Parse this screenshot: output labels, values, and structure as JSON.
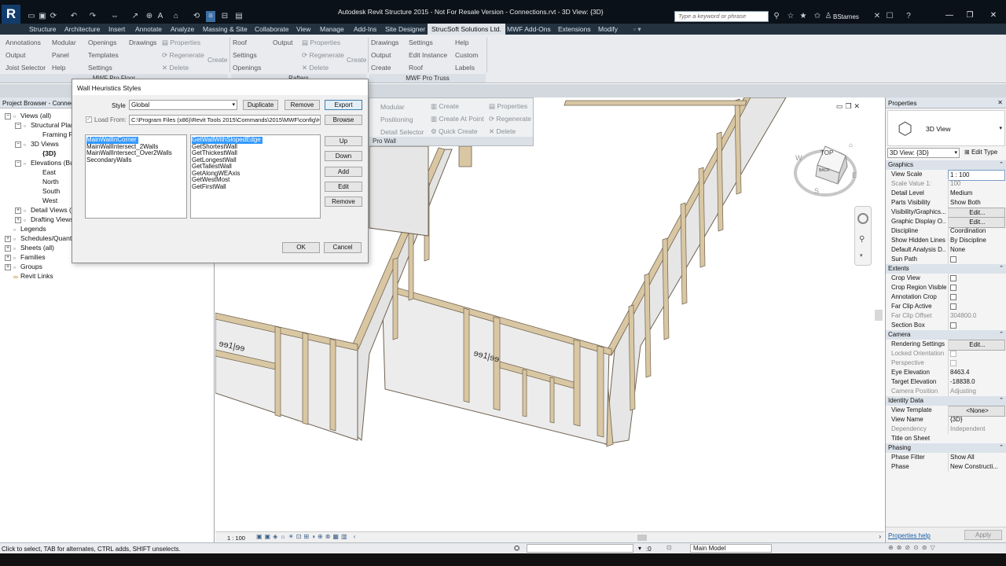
{
  "app": {
    "title": "Autodesk Revit Structure 2015 - Not For Resale Version -     Connections.rvt - 3D View: {3D}",
    "logo_letter": "R",
    "search_placeholder": "Type a keyword or phrase",
    "user": "BStarnes"
  },
  "tabs": [
    "Structure",
    "Architecture",
    "Insert",
    "Annotate",
    "Analyze",
    "Massing & Site",
    "Collaborate",
    "View",
    "Manage",
    "Add-Ins",
    "Site Designer",
    "StrucSoft Solutions Ltd.",
    "MWF Add-Ons",
    "Extensions",
    "Modify"
  ],
  "active_tab": "StrucSoft Solutions Ltd.",
  "ribbon": {
    "floor": {
      "annotations": "Annotations",
      "modular": "Modular",
      "openings": "Openings",
      "drawings": "Drawings",
      "properties": "Properties",
      "output": "Output",
      "panel": "Panel",
      "templates": "Templates",
      "regenerate": "Regenerate",
      "create": "Create",
      "joist_selector": "Joist Selector",
      "help": "Help",
      "settings": "Settings",
      "delete": "Delete",
      "panel_label": "MWF Pro Floor"
    },
    "rafters": {
      "roof": "Roof",
      "output": "Output",
      "properties": "Properties",
      "settings": "Settings",
      "regenerate": "Regenerate",
      "create": "Create",
      "openings": "Openings",
      "delete": "Delete",
      "panel_label": "Rafters"
    },
    "truss": {
      "drawings": "Drawings",
      "settings": "Settings",
      "help": "Help",
      "output": "Output",
      "edit_instance": "Edit Instance",
      "custom": "Custom",
      "create": "Create",
      "roof": "Roof",
      "labels": "Labels",
      "panel_label": "MWF Pro Truss"
    }
  },
  "wall_panel": {
    "modular": "Modular",
    "create": "Create",
    "properties": "Properties",
    "positioning": "Positioning",
    "create_at_point": "Create At Point",
    "regenerate": "Regenerate",
    "detail_selector": "Detail Selector",
    "quick_create": "Quick Create",
    "delete": "Delete",
    "panel_label": "Pro Wall"
  },
  "project_browser": {
    "title": "Project Browser - Connecti",
    "items": [
      {
        "label": "Views (all)",
        "toggle": "−"
      },
      {
        "label": "Structural Plans",
        "toggle": "−"
      },
      {
        "label": "Framing Plan",
        "toggle": ""
      },
      {
        "label": "3D Views",
        "toggle": "−"
      },
      {
        "label": "{3D}",
        "toggle": ""
      },
      {
        "label": "Elevations (Buildin",
        "toggle": "−"
      },
      {
        "label": "East",
        "toggle": ""
      },
      {
        "label": "North",
        "toggle": ""
      },
      {
        "label": "South",
        "toggle": ""
      },
      {
        "label": "West",
        "toggle": ""
      },
      {
        "label": "Detail Views (Deta",
        "toggle": "+"
      },
      {
        "label": "Drafting Views (D",
        "toggle": "+"
      },
      {
        "label": "Legends",
        "toggle": ""
      },
      {
        "label": "Schedules/Quanti",
        "toggle": "+"
      },
      {
        "label": "Sheets (all)",
        "toggle": "+"
      },
      {
        "label": "Families",
        "toggle": "+"
      },
      {
        "label": "Groups",
        "toggle": "+"
      },
      {
        "label": "Revit Links",
        "toggle": ""
      }
    ]
  },
  "dialog": {
    "title": "Wall Heuristics Styles",
    "style_label": "Style",
    "style_value": "Global",
    "duplicate": "Duplicate",
    "remove": "Remove",
    "export": "Export",
    "load_from_label": "Load From:",
    "load_from_value": "C:\\Program Files (x86)\\Revit Tools 2015\\Commands\\2015\\MWF\\config\\He",
    "browse": "Browse",
    "left_list": [
      "MainWallInCorner",
      "MainWallIntersect_2Walls",
      "MainWallIntersect_Over2Walls",
      "SecondaryWalls"
    ],
    "left_selected": 0,
    "right_list": [
      "GetWallWithSlopedEdge",
      "GetShortestWall",
      "GetThickestWall",
      "GetLongestWall",
      "GetTallestWall",
      "GetAlongWEAxis",
      "GetWestMost",
      "GetFirstWall"
    ],
    "right_selected": 0,
    "up": "Up",
    "down": "Down",
    "add": "Add",
    "edit": "Edit",
    "remove2": "Remove",
    "ok": "OK",
    "cancel": "Cancel"
  },
  "viewcube": {
    "face": "TOP",
    "side": "BACK",
    "compass_w": "W",
    "compass_e": "E",
    "compass_s": "S"
  },
  "view_bar": {
    "scale": "1 : 100"
  },
  "properties": {
    "title": "Properties",
    "type_name": "3D View",
    "selector": "3D View: {3D}",
    "edit_type": "Edit Type",
    "sections": [
      {
        "name": "Graphics",
        "rows": [
          {
            "k": "View Scale",
            "v": "1 : 100",
            "kind": "text"
          },
          {
            "k": "Scale Value   1:",
            "v": "100",
            "kind": "dim"
          },
          {
            "k": "Detail Level",
            "v": "Medium",
            "kind": "text"
          },
          {
            "k": "Parts Visibility",
            "v": "Show Both",
            "kind": "text"
          },
          {
            "k": "Visibility/Graphics...",
            "v": "Edit...",
            "kind": "btn"
          },
          {
            "k": "Graphic Display O...",
            "v": "Edit...",
            "kind": "btn"
          },
          {
            "k": "Discipline",
            "v": "Coordination",
            "kind": "text"
          },
          {
            "k": "Show Hidden Lines",
            "v": "By Discipline",
            "kind": "text"
          },
          {
            "k": "Default Analysis D...",
            "v": "None",
            "kind": "text"
          },
          {
            "k": "Sun Path",
            "v": "",
            "kind": "chk"
          }
        ]
      },
      {
        "name": "Extents",
        "rows": [
          {
            "k": "Crop View",
            "v": "",
            "kind": "chk"
          },
          {
            "k": "Crop Region Visible",
            "v": "",
            "kind": "chk"
          },
          {
            "k": "Annotation Crop",
            "v": "",
            "kind": "chk"
          },
          {
            "k": "Far Clip Active",
            "v": "",
            "kind": "chk"
          },
          {
            "k": "Far Clip Offset",
            "v": "304800.0",
            "kind": "dim"
          },
          {
            "k": "Section Box",
            "v": "",
            "kind": "chk"
          }
        ]
      },
      {
        "name": "Camera",
        "rows": [
          {
            "k": "Rendering Settings",
            "v": "Edit...",
            "kind": "btn"
          },
          {
            "k": "Locked Orientation",
            "v": "",
            "kind": "chkdim"
          },
          {
            "k": "Perspective",
            "v": "",
            "kind": "chkdim"
          },
          {
            "k": "Eye Elevation",
            "v": "8463.4",
            "kind": "text"
          },
          {
            "k": "Target Elevation",
            "v": "-18838.0",
            "kind": "text"
          },
          {
            "k": "Camera Position",
            "v": "Adjusting",
            "kind": "dim"
          }
        ]
      },
      {
        "name": "Identity Data",
        "rows": [
          {
            "k": "View Template",
            "v": "<None>",
            "kind": "btn"
          },
          {
            "k": "View Name",
            "v": "{3D}",
            "kind": "text"
          },
          {
            "k": "Dependency",
            "v": "Independent",
            "kind": "dim"
          },
          {
            "k": "Title on Sheet",
            "v": "",
            "kind": "text"
          }
        ]
      },
      {
        "name": "Phasing",
        "rows": [
          {
            "k": "Phase Filter",
            "v": "Show All",
            "kind": "text"
          },
          {
            "k": "Phase",
            "v": "New Constructi...",
            "kind": "text"
          }
        ]
      }
    ],
    "help_link": "Properties help",
    "apply": "Apply"
  },
  "status": {
    "text": "Click to select, TAB for alternates, CTRL adds, SHIFT unselects.",
    "selection_count": ":0",
    "model": "Main Model"
  },
  "colors": {
    "titlebar": "#0b1118",
    "tabs": "#243240",
    "ribbon": "#e9ebee",
    "wood": "#d9c7a3",
    "wall": "#e6e6e6",
    "selection": "#3399ff"
  }
}
